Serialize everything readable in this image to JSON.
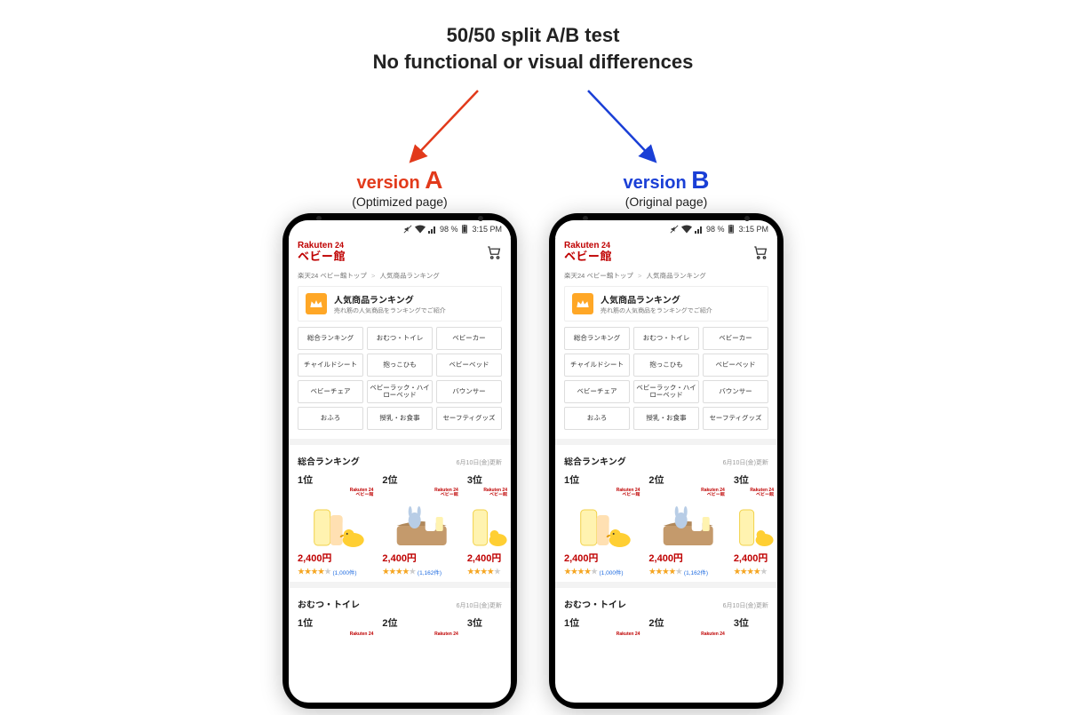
{
  "header": {
    "line1": "50/50 split A/B test",
    "line2": "No functional or visual differences"
  },
  "versions": {
    "a": {
      "label_prefix": "version",
      "letter": "A",
      "subtitle": "(Optimized page)"
    },
    "b": {
      "label_prefix": "version",
      "letter": "B",
      "subtitle": "(Original page)"
    }
  },
  "colors": {
    "a": "#e23a1b",
    "b": "#1a3fd6"
  },
  "statusbar": {
    "battery": "98 %",
    "time": "3:15 PM"
  },
  "logo": {
    "line1a": "Rakuten",
    "line1b": " 24",
    "line2": "ベビー館"
  },
  "breadcrumb": {
    "parts": [
      "楽天24 ベビー館トップ",
      "人気商品ランキング"
    ],
    "sep": ">"
  },
  "ranking_card": {
    "title": "人気商品ランキング",
    "subtitle": "売れ筋の人気商品をランキングでご紹介"
  },
  "categories": [
    "総合ランキング",
    "おむつ・トイレ",
    "ベビーカー",
    "チャイルドシート",
    "抱っこひも",
    "ベビーベッド",
    "ベビーチェア",
    "ベビーラック・ハイローベッド",
    "バウンサー",
    "おふろ",
    "授乳・お食事",
    "セーフティグッズ"
  ],
  "sections": [
    {
      "title": "総合ランキング",
      "updated": "6月10日(金)更新",
      "ranks": [
        "1位",
        "2位",
        "3位"
      ],
      "products": [
        {
          "price": "2,400円",
          "review_count": "(1,000件)",
          "stars5": "★★★★",
          "stars_dim": "★",
          "thumb_kind": "duck"
        },
        {
          "price": "2,400円",
          "review_count": "(1,162件)",
          "stars5": "★★★★",
          "stars_dim": "★",
          "thumb_kind": "basket"
        },
        {
          "price": "2,400円",
          "review_count": "",
          "stars5": "★★★★",
          "stars_dim": "★",
          "thumb_kind": "duck"
        }
      ]
    },
    {
      "title": "おむつ・トイレ",
      "updated": "6月10日(金)更新",
      "ranks": [
        "1位",
        "2位",
        "3位"
      ]
    }
  ],
  "seller_mini": "ベビー館"
}
